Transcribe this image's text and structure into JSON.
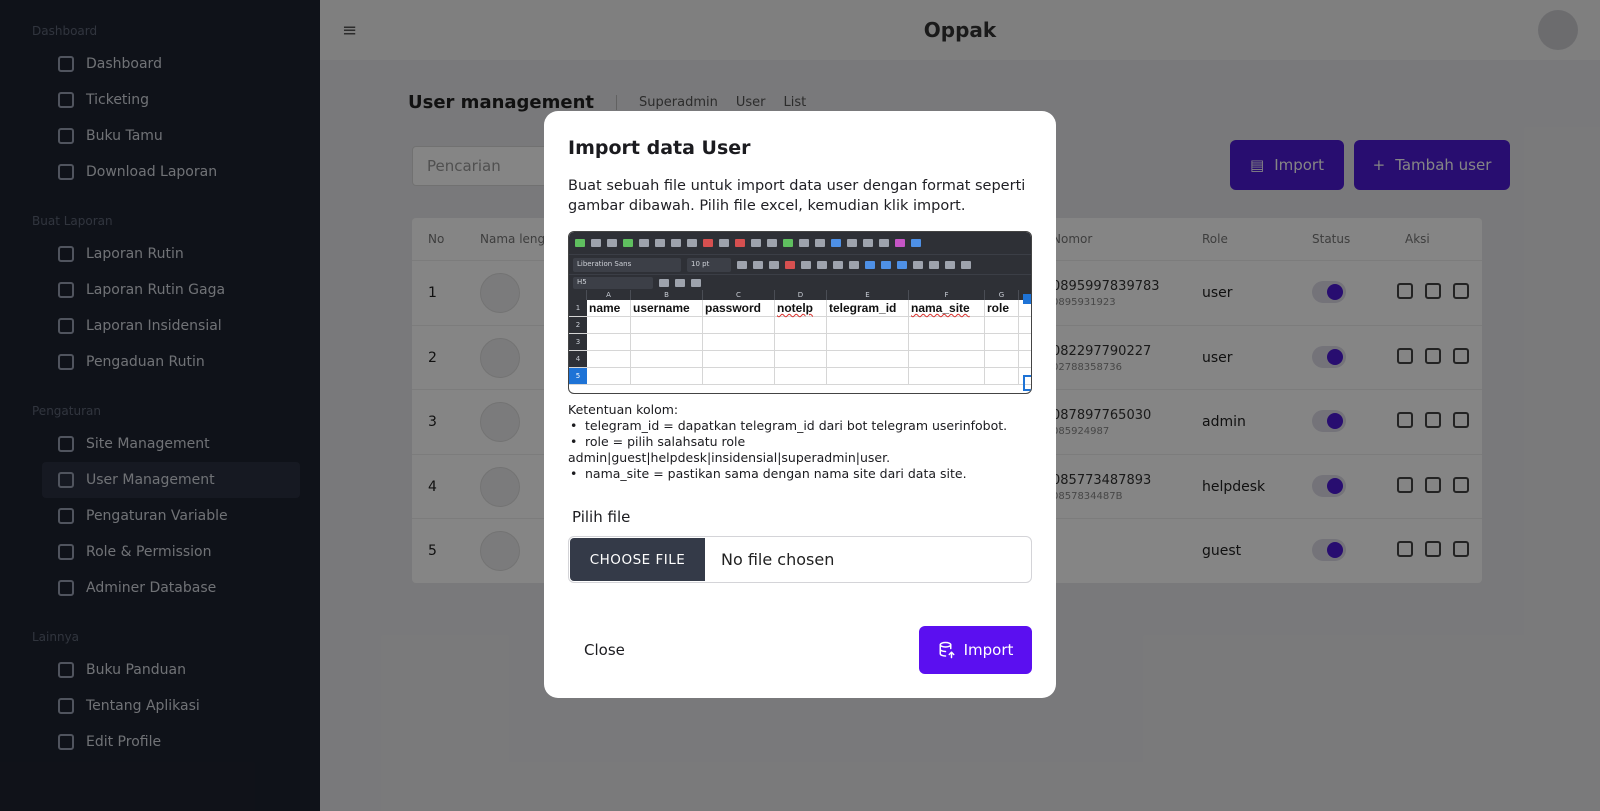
{
  "sidebar": {
    "sections": [
      {
        "title": "Dashboard",
        "items": [
          "Dashboard",
          "Ticketing",
          "Buku Tamu",
          "Download Laporan"
        ]
      },
      {
        "title": "Buat Laporan",
        "items": [
          "Laporan Rutin",
          "Laporan Rutin Gaga",
          "Laporan Insidensial",
          "Pengaduan Rutin"
        ]
      },
      {
        "title": "Pengaturan",
        "items": [
          "Site Management",
          "User Management",
          "Pengaturan Variable",
          "Role & Permission",
          "Adminer Database"
        ]
      },
      {
        "title": "Lainnya",
        "items": [
          "Buku Panduan",
          "Tentang Aplikasi",
          "Edit Profile"
        ]
      }
    ]
  },
  "topbar": {
    "brand": "Oppak"
  },
  "page": {
    "title": "User management",
    "crumbs": [
      "Superadmin",
      "User",
      "List"
    ],
    "search_placeholder": "Pencarian",
    "btn_import": "Import",
    "btn_add": "Tambah user",
    "headers": [
      "No",
      "Nama lengkap",
      "Nomor",
      "Role",
      "Status",
      "Aksi"
    ],
    "rows": [
      {
        "no": "1",
        "phone": "0895997839783",
        "sub": "0895931923",
        "role": "user"
      },
      {
        "no": "2",
        "phone": "082297790227",
        "sub": "02788358736",
        "role": "user"
      },
      {
        "no": "3",
        "phone": "087897765030",
        "sub": "085924987",
        "role": "admin"
      },
      {
        "no": "4",
        "phone": "085773487893",
        "sub": "0857834487B",
        "role": "helpdesk"
      },
      {
        "no": "5",
        "phone": "",
        "sub": "",
        "role": "guest"
      }
    ]
  },
  "modal": {
    "title": "Import data User",
    "description": "Buat sebuah file untuk import data user dengan format seperti gambar dibawah. Pilih file excel, kemudian klik import.",
    "sheet": {
      "font_name": "Liberation Sans",
      "font_size": "10 pt",
      "cell_ref": "H5",
      "columns": [
        "A",
        "B",
        "C",
        "D",
        "E",
        "F",
        "G"
      ],
      "headers": [
        "name",
        "username",
        "password",
        "notelp",
        "telegram_id",
        "nama_site",
        "role"
      ],
      "row_numbers": [
        "1",
        "2",
        "3",
        "4",
        "5"
      ]
    },
    "rules_title": "Ketentuan kolom:",
    "rule_1": "telegram_id = dapatkan telegram_id dari bot telegram userinfobot.",
    "rule_2a": "role = pilih salahsatu role",
    "rule_2b": "admin|guest|helpdesk|insidensial|superadmin|user.",
    "rule_3": "nama_site = pastikan sama dengan nama site dari data site.",
    "file_label": "Pilih file",
    "choose_file": "CHOOSE FILE",
    "no_file": "No file chosen",
    "close": "Close",
    "import": "Import"
  }
}
